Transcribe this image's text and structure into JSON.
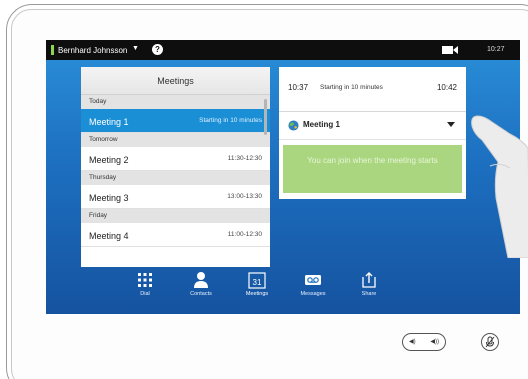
{
  "status_bar": {
    "user_name": "Bernhard Johnsson",
    "caret": "▼",
    "help": "?",
    "clock": "10:27"
  },
  "meetings": {
    "title": "Meetings",
    "groups": [
      {
        "day": "Today",
        "items": [
          {
            "name": "Meeting 1",
            "time": "Starting in 10 minutes",
            "selected": true
          }
        ]
      },
      {
        "day": "Tomorrow",
        "items": [
          {
            "name": "Meeting 2",
            "time": "11:30-12:30"
          }
        ]
      },
      {
        "day": "Thursday",
        "items": [
          {
            "name": "Meeting 3",
            "time": "13:00-13:30"
          }
        ]
      },
      {
        "day": "Friday",
        "items": [
          {
            "name": "Meeting 4",
            "time": "11:00-12:30"
          }
        ]
      }
    ]
  },
  "detail": {
    "start_time": "10:37",
    "status": "Starting in 10 minutes",
    "end_time": "10:42",
    "meeting_title": "Meeting 1",
    "join_message": "You can join when the meeting starts"
  },
  "nav": {
    "items": [
      {
        "label": "Dial",
        "icon": "dial-icon"
      },
      {
        "label": "Contacts",
        "icon": "contacts-icon"
      },
      {
        "label": "Meetings",
        "icon": "calendar-icon",
        "badge": "31",
        "active": true
      },
      {
        "label": "Messages",
        "icon": "voicemail-icon"
      },
      {
        "label": "Share",
        "icon": "share-icon"
      }
    ]
  },
  "colors": {
    "selected_row": "#1b8fd6",
    "join_button": "#a9d67e",
    "status_indicator": "#8bd64a"
  }
}
